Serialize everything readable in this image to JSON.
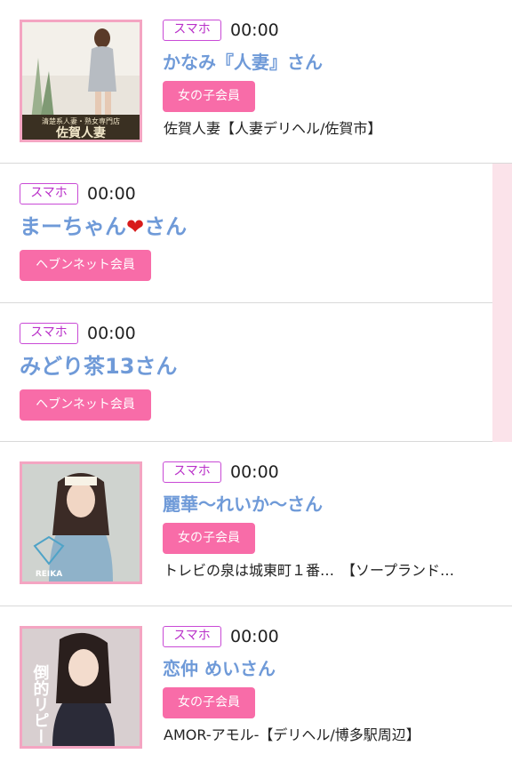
{
  "items": [
    {
      "device": "スマホ",
      "time": "00:00",
      "name": "かなみ『人妻』さん",
      "badge": "女の子会員",
      "shop": "佐賀人妻【人妻デリヘル/佐賀市】",
      "thumb_text": [
        "清楚系人妻・熟女専門店",
        "佐賀人妻"
      ]
    },
    {
      "device": "スマホ",
      "time": "00:00",
      "name_prefix": "まーちゃん",
      "name_heart": "❤",
      "name_suffix": "さん",
      "badge": "ヘブンネット会員"
    },
    {
      "device": "スマホ",
      "time": "00:00",
      "name": "みどり茶13さん",
      "badge": "ヘブンネット会員"
    },
    {
      "device": "スマホ",
      "time": "00:00",
      "name": "麗華〜れいか〜さん",
      "badge": "女の子会員",
      "shop": "トレビの泉は城東町１番…　【ソープランド…",
      "thumb_text": [
        "REIKA"
      ]
    },
    {
      "device": "スマホ",
      "time": "00:00",
      "name": "恋仲 めいさん",
      "badge": "女の子会員",
      "shop": "AMOR-アモル-【デリヘル/博多駅周辺】",
      "thumb_text": [
        "倒的リピー"
      ]
    }
  ]
}
